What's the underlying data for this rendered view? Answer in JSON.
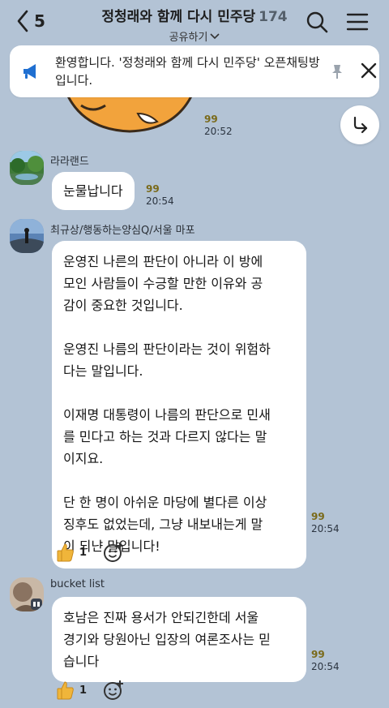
{
  "header": {
    "back_count": "5",
    "title": "정청래와 함께 다시 민주당",
    "members": "174",
    "share_label": "공유하기"
  },
  "notice": {
    "text": "환영합니다. '정청래와 함께 다시 민주당' 오픈채팅방입니다."
  },
  "prev_message": {
    "unread": "99",
    "time": "20:52"
  },
  "messages": [
    {
      "sender": "라라랜드",
      "text": "눈물납니다",
      "unread": "99",
      "time": "20:54"
    },
    {
      "sender": "최규상/행동하는양심Q/서울 마포",
      "text": "운영진 나른의 판단이 아니라 이 방에\n모인 사람들이 수긍할 만한 이유와 공\n감이 중요한 것입니다.\n\n운영진 나름의 판단이라는 것이 위험하\n다는 말입니다.\n\n이재명 대통령이 나름의 판단으로 민새\n를 민다고 하는 것과 다르지 않다는 말\n이지요.\n\n단 한 명이 아쉬운 마당에 별다른 이상\n징후도 없었는데, 그냥 내보내는게 말\n이 되냔 말입니다!",
      "unread": "99",
      "time": "20:54",
      "likes": "1"
    },
    {
      "sender": "bucket list",
      "text": "호남은 진짜 용서가 안되긴한데 서울\n경기와 당원아닌 입장의 여론조사는 믿\n습니다",
      "unread": "99",
      "time": "20:54",
      "likes": "1"
    }
  ],
  "colors": {
    "background": "#b3c3d5",
    "bubble": "#ffffff",
    "unread": "#7a6a1a",
    "notice_icon": "#1f6fd1"
  }
}
